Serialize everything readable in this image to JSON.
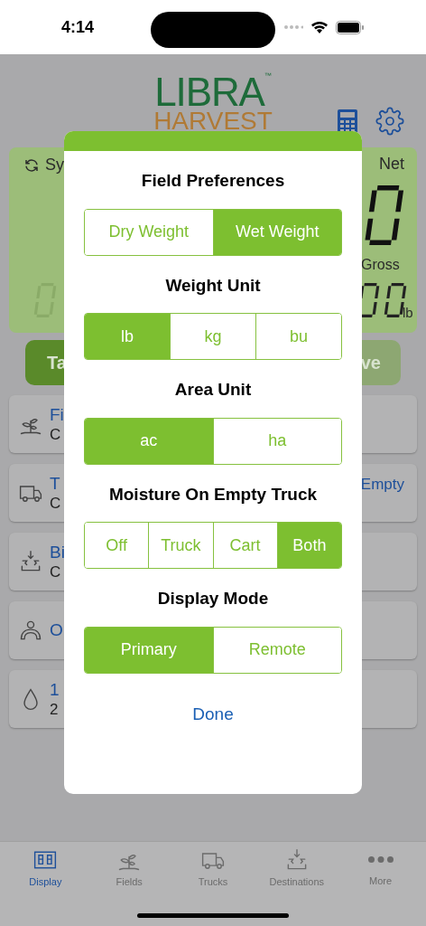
{
  "status_bar": {
    "time": "4:14"
  },
  "logo": {
    "line1": "LIBRA",
    "trademark": "™",
    "line2": "HARVEST"
  },
  "display_panel": {
    "sync_label": "Sy",
    "net_label": "Net",
    "gross_label": "Gross",
    "unit": "lb"
  },
  "action_buttons": [
    {
      "label": "Ta",
      "kind": "primary"
    },
    {
      "label": "ve",
      "kind": "secondary"
    }
  ],
  "list_cards": [
    {
      "kind": "field",
      "title": "Fi",
      "subtitle": "C"
    },
    {
      "kind": "truck",
      "title": "T",
      "subtitle": "C",
      "right": "Empty"
    },
    {
      "kind": "bin",
      "title": "Bi",
      "subtitle": "C"
    },
    {
      "kind": "operator",
      "title": "O"
    },
    {
      "kind": "moisture",
      "title": "1",
      "subtitle": "2"
    }
  ],
  "dialog": {
    "sections": [
      {
        "title": "Field Preferences",
        "options": [
          {
            "label": "Dry Weight",
            "selected": false
          },
          {
            "label": "Wet Weight",
            "selected": true
          }
        ]
      },
      {
        "title": "Weight Unit",
        "options": [
          {
            "label": "lb",
            "selected": true
          },
          {
            "label": "kg",
            "selected": false
          },
          {
            "label": "bu",
            "selected": false
          }
        ]
      },
      {
        "title": "Area Unit",
        "options": [
          {
            "label": "ac",
            "selected": true
          },
          {
            "label": "ha",
            "selected": false
          }
        ]
      },
      {
        "title": "Moisture On Empty Truck",
        "options": [
          {
            "label": "Off",
            "selected": false
          },
          {
            "label": "Truck",
            "selected": false
          },
          {
            "label": "Cart",
            "selected": false
          },
          {
            "label": "Both",
            "selected": true
          }
        ]
      },
      {
        "title": "Display Mode",
        "options": [
          {
            "label": "Primary",
            "selected": true
          },
          {
            "label": "Remote",
            "selected": false
          }
        ]
      }
    ],
    "done": "Done"
  },
  "tab_bar": [
    {
      "label": "Display",
      "kind": "display",
      "selected": true
    },
    {
      "label": "Fields",
      "kind": "field",
      "selected": false
    },
    {
      "label": "Trucks",
      "kind": "truck",
      "selected": false
    },
    {
      "label": "Destinations",
      "kind": "bin",
      "selected": false
    },
    {
      "label": "More",
      "kind": "more",
      "selected": false
    }
  ]
}
